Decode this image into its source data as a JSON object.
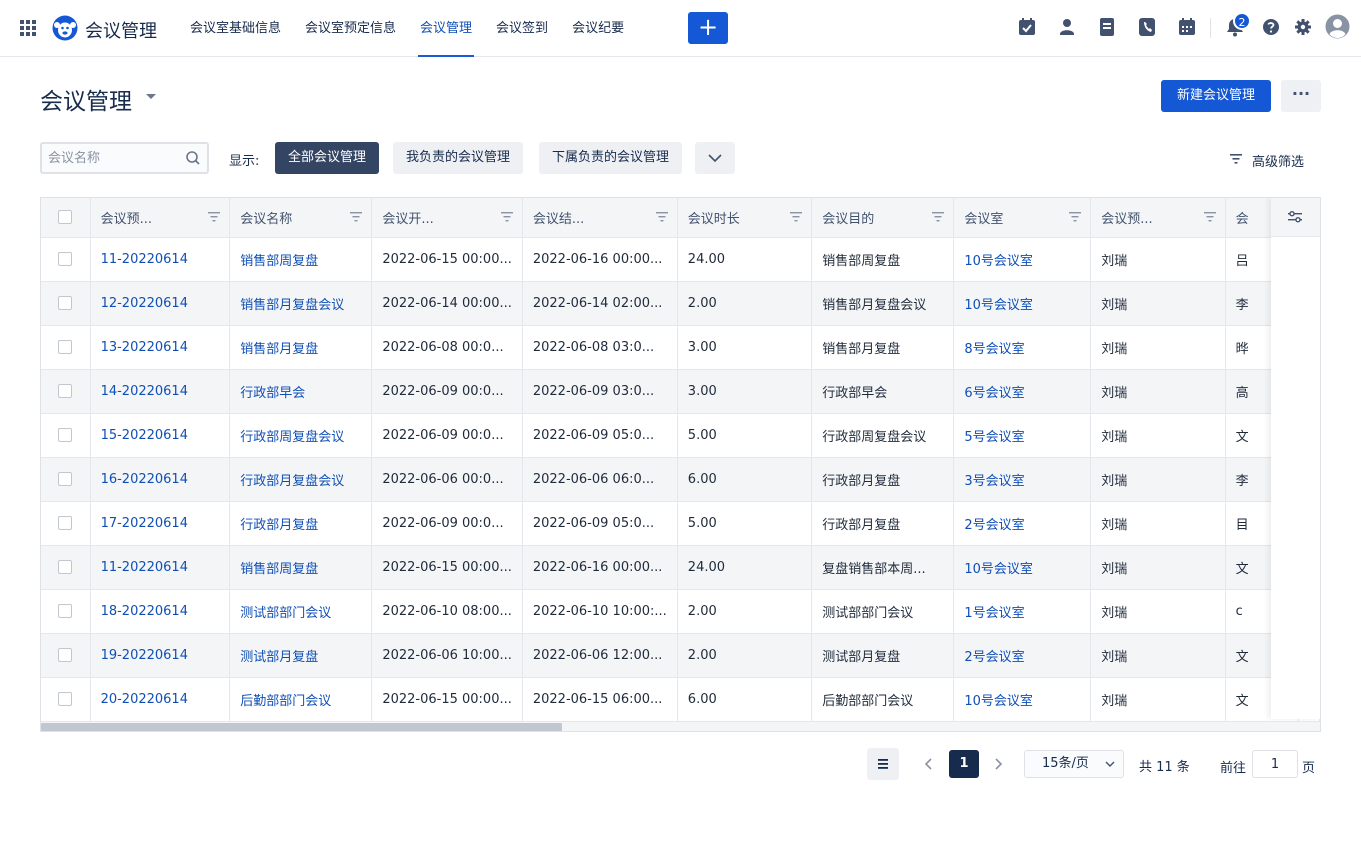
{
  "app": {
    "title": "会议管理",
    "nav": [
      {
        "label": "会议室基础信息",
        "active": false
      },
      {
        "label": "会议室预定信息",
        "active": false
      },
      {
        "label": "会议管理",
        "active": true
      },
      {
        "label": "会议签到",
        "active": false
      },
      {
        "label": "会议纪要",
        "active": false
      }
    ],
    "create_label": "+",
    "notification_count": "2",
    "accent_color": "#1558d6"
  },
  "page": {
    "title": "会议管理",
    "new_button": "新建会议管理",
    "more_button": "···"
  },
  "filters": {
    "search_placeholder": "会议名称",
    "show_label": "显示:",
    "tabs": [
      {
        "label": "全部会议管理",
        "active": true
      },
      {
        "label": "我负责的会议管理",
        "active": false
      },
      {
        "label": "下属负责的会议管理",
        "active": false
      }
    ],
    "advanced": "高级筛选"
  },
  "table": {
    "columns": [
      "会议预...",
      "会议名称",
      "会议开...",
      "会议结...",
      "会议时长",
      "会议目的",
      "会议室",
      "会议预...",
      "会"
    ],
    "rows": [
      {
        "code": "11-20220614",
        "name": "销售部周复盘",
        "start": "2022-06-15 00:00...",
        "end": "2022-06-16 00:00...",
        "duration": "24.00",
        "purpose": "销售部周复盘",
        "room": "10号会议室",
        "booker": "刘瑞",
        "extra": "吕"
      },
      {
        "code": "12-20220614",
        "name": "销售部月复盘会议",
        "start": "2022-06-14 00:00...",
        "end": "2022-06-14 02:00...",
        "duration": "2.00",
        "purpose": "销售部月复盘会议",
        "room": "10号会议室",
        "booker": "刘瑞",
        "extra": "李"
      },
      {
        "code": "13-20220614",
        "name": "销售部月复盘",
        "start": "2022-06-08 00:0...",
        "end": "2022-06-08 03:0...",
        "duration": "3.00",
        "purpose": "销售部月复盘",
        "room": "8号会议室",
        "booker": "刘瑞",
        "extra": "晔"
      },
      {
        "code": "14-20220614",
        "name": "行政部早会",
        "start": "2022-06-09 00:0...",
        "end": "2022-06-09 03:0...",
        "duration": "3.00",
        "purpose": "行政部早会",
        "room": "6号会议室",
        "booker": "刘瑞",
        "extra": "高"
      },
      {
        "code": "15-20220614",
        "name": "行政部周复盘会议",
        "start": "2022-06-09 00:0...",
        "end": "2022-06-09 05:0...",
        "duration": "5.00",
        "purpose": "行政部周复盘会议",
        "room": "5号会议室",
        "booker": "刘瑞",
        "extra": "文"
      },
      {
        "code": "16-20220614",
        "name": "行政部月复盘会议",
        "start": "2022-06-06 00:0...",
        "end": "2022-06-06 06:0...",
        "duration": "6.00",
        "purpose": "行政部月复盘",
        "room": "3号会议室",
        "booker": "刘瑞",
        "extra": "李"
      },
      {
        "code": "17-20220614",
        "name": "行政部月复盘",
        "start": "2022-06-09 00:0...",
        "end": "2022-06-09 05:0...",
        "duration": "5.00",
        "purpose": "行政部月复盘",
        "room": "2号会议室",
        "booker": "刘瑞",
        "extra": "目"
      },
      {
        "code": "11-20220614",
        "name": "销售部周复盘",
        "start": "2022-06-15 00:00...",
        "end": "2022-06-16 00:00...",
        "duration": "24.00",
        "purpose": "复盘销售部本周...",
        "room": "10号会议室",
        "booker": "刘瑞",
        "extra": "文"
      },
      {
        "code": "18-20220614",
        "name": "测试部部门会议",
        "start": "2022-06-10 08:00...",
        "end": "2022-06-10 10:00:...",
        "duration": "2.00",
        "purpose": "测试部部门会议",
        "room": "1号会议室",
        "booker": "刘瑞",
        "extra": "c"
      },
      {
        "code": "19-20220614",
        "name": "测试部月复盘",
        "start": "2022-06-06 10:00...",
        "end": "2022-06-06 12:00...",
        "duration": "2.00",
        "purpose": "测试部月复盘",
        "room": "2号会议室",
        "booker": "刘瑞",
        "extra": "文"
      },
      {
        "code": "20-20220614",
        "name": "后勤部部门会议",
        "start": "2022-06-15 00:00...",
        "end": "2022-06-15 06:00...",
        "duration": "6.00",
        "purpose": "后勤部部门会议",
        "room": "10号会议室",
        "booker": "刘瑞",
        "extra": "文"
      }
    ]
  },
  "pagination": {
    "current_page": "1",
    "page_size": "15条/页",
    "total": "共 11 条",
    "goto_label": "前往",
    "goto_value": "1",
    "page_suffix": "页"
  }
}
